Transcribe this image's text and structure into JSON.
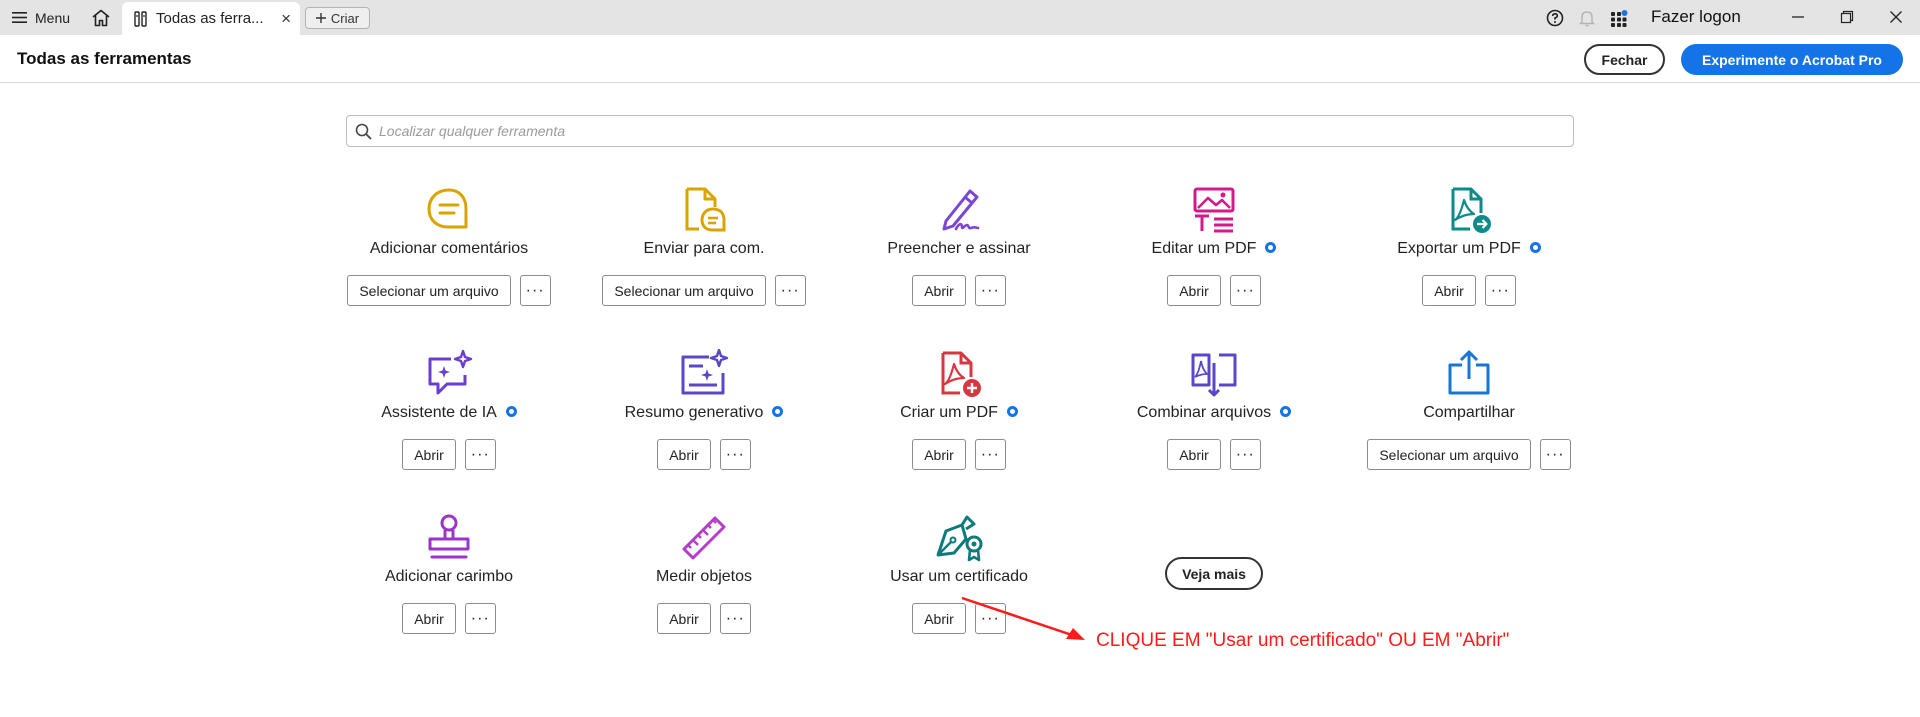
{
  "titlebar": {
    "menu_label": "Menu",
    "tab_label": "Todas as ferra...",
    "tab_close": "×",
    "new_label": "Criar",
    "login_label": "Fazer logon",
    "icons": [
      "help-icon",
      "bell-icon",
      "apps-grid-icon"
    ],
    "window_controls": [
      "minimize-icon",
      "restore-icon",
      "close-icon"
    ]
  },
  "header": {
    "title": "Todas as ferramentas",
    "close_label": "Fechar",
    "pro_label": "Experimente o Acrobat Pro"
  },
  "search": {
    "placeholder": "Localizar qualquer ferramenta",
    "value": ""
  },
  "tools": [
    {
      "name": "Adicionar comentários",
      "action": "Selecionar um arquivo",
      "more": "···",
      "pro": false,
      "icon": "comment-icon"
    },
    {
      "name": "Enviar para com.",
      "action": "Selecionar um arquivo",
      "more": "···",
      "pro": false,
      "icon": "send-comment-icon"
    },
    {
      "name": "Preencher e assinar",
      "action": "Abrir",
      "more": "···",
      "pro": false,
      "icon": "fill-sign-icon"
    },
    {
      "name": "Editar um PDF",
      "action": "Abrir",
      "more": "···",
      "pro": true,
      "icon": "edit-pdf-icon"
    },
    {
      "name": "Exportar um PDF",
      "action": "Abrir",
      "more": "···",
      "pro": true,
      "icon": "export-pdf-icon"
    },
    {
      "name": "Assistente de IA",
      "action": "Abrir",
      "more": "···",
      "pro": true,
      "icon": "ai-assistant-icon"
    },
    {
      "name": "Resumo generativo",
      "action": "Abrir",
      "more": "···",
      "pro": true,
      "icon": "generative-summary-icon"
    },
    {
      "name": "Criar um PDF",
      "action": "Abrir",
      "more": "···",
      "pro": true,
      "icon": "create-pdf-icon"
    },
    {
      "name": "Combinar arquivos",
      "action": "Abrir",
      "more": "···",
      "pro": true,
      "icon": "combine-files-icon"
    },
    {
      "name": "Compartilhar",
      "action": "Selecionar um arquivo",
      "more": "···",
      "pro": false,
      "icon": "share-icon"
    },
    {
      "name": "Adicionar carimbo",
      "action": "Abrir",
      "more": "···",
      "pro": false,
      "icon": "stamp-icon"
    },
    {
      "name": "Medir objetos",
      "action": "Abrir",
      "more": "···",
      "pro": false,
      "icon": "ruler-icon"
    },
    {
      "name": "Usar um certificado",
      "action": "Abrir",
      "more": "···",
      "pro": false,
      "icon": "certificate-icon"
    }
  ],
  "see_more_label": "Veja mais",
  "annotation": {
    "text": "CLIQUE EM \"Usar um certificado\" OU EM \"Abrir\"",
    "color": "#ff1a1a"
  },
  "colors": {
    "accent": "#1473e6",
    "comment": "#d9a400",
    "purple": "#7b46d6",
    "magenta": "#d21a8c",
    "teal": "#0e8a8a",
    "red": "#d7373f",
    "blue": "#1a75d2"
  }
}
